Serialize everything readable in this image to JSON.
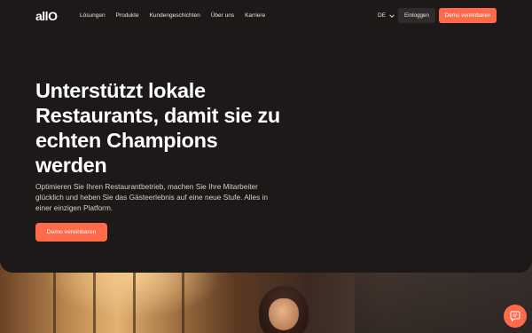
{
  "brand": {
    "logo_text": "allO"
  },
  "nav": {
    "links": [
      "Lösungen",
      "Produkte",
      "Kundengeschichten",
      "Über uns",
      "Karriere"
    ],
    "language": "DE",
    "login_label": "Einloggen",
    "demo_label": "Demo vereinbaren"
  },
  "hero": {
    "headline": "Unterstützt lokale Restaurants, damit sie zu echten Champions werden",
    "subtext": "Optimieren Sie Ihren Restaurantbetrieb, machen Sie Ihre Mitarbeiter glücklich und heben Sie das Gästeerlebnis auf eine neue Stufe. Alles in einer einzigen Platform.",
    "cta_label": "Demo vereinbaren"
  },
  "colors": {
    "accent": "#ff6b4a",
    "hero_background": "#1c1918"
  },
  "icons": {
    "language_dropdown": "chevron-down-icon",
    "chat": "chat-icon"
  }
}
